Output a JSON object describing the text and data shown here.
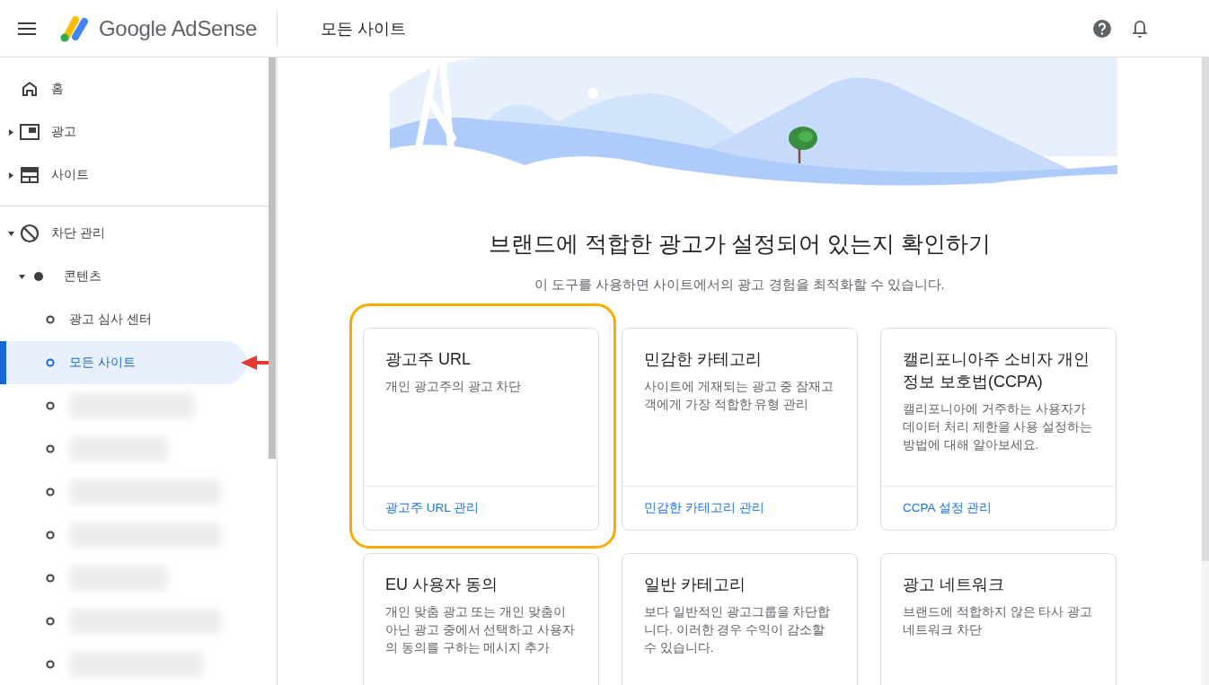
{
  "header": {
    "brand": "Google AdSense",
    "page_title": "모든 사이트"
  },
  "sidebar": {
    "groups": [
      {
        "items": [
          {
            "kind": "home",
            "label": "홈",
            "selected": false
          },
          {
            "kind": "ads",
            "label": "광고",
            "selected": false,
            "expanded": false
          },
          {
            "kind": "sites",
            "label": "사이트",
            "selected": false,
            "expanded": false
          }
        ]
      },
      {
        "items": [
          {
            "kind": "block",
            "label": "차단 관리",
            "selected": false,
            "expanded": true,
            "children": [
              {
                "kind": "dot",
                "label": "콘텐츠",
                "selected": false,
                "expanded": true,
                "children": [
                  {
                    "kind": "ring",
                    "label": "광고 심사 센터",
                    "selected": false
                  },
                  {
                    "kind": "ring",
                    "label": "모든 사이트",
                    "selected": true
                  },
                  {
                    "kind": "redacted",
                    "selected": false
                  },
                  {
                    "kind": "redacted",
                    "selected": false
                  },
                  {
                    "kind": "redacted",
                    "selected": false
                  },
                  {
                    "kind": "redacted",
                    "selected": false
                  },
                  {
                    "kind": "redacted",
                    "selected": false
                  },
                  {
                    "kind": "redacted",
                    "selected": false
                  },
                  {
                    "kind": "redacted",
                    "selected": false
                  }
                ]
              }
            ]
          }
        ]
      }
    ]
  },
  "main": {
    "heading": "브랜드에 적합한 광고가 설정되어 있는지 확인하기",
    "subtitle": "이 도구를 사용하면 사이트에서의 광고 경험을 최적화할 수 있습니다.",
    "cards": [
      {
        "title": "광고주 URL",
        "description": "개인 광고주의 광고 차단",
        "link": "광고주 URL 관리",
        "highlighted": true
      },
      {
        "title": "민감한 카테고리",
        "description": "사이트에 게재되는 광고 중 잠재고객에게 가장 적합한 유형 관리",
        "link": "민감한 카테고리 관리",
        "highlighted": false
      },
      {
        "title": "캘리포니아주 소비자 개인 정보 보호법(CCPA)",
        "description": "캘리포니아에 거주하는 사용자가 데이터 처리 제한을 사용 설정하는 방법에 대해 알아보세요.",
        "link": "CCPA 설정 관리",
        "highlighted": false
      },
      {
        "title": "EU 사용자 동의",
        "description": "개인 맞춤 광고 또는 개인 맞춤이 아닌 광고 중에서 선택하고 사용자의 동의를 구하는 메시지 추가",
        "highlighted": false
      },
      {
        "title": "일반 카테고리",
        "description": "보다 일반적인 광고그룹을 차단합니다. 이러한 경우 수익이 감소할 수 있습니다.",
        "highlighted": false
      },
      {
        "title": "광고 네트워크",
        "description": "브랜드에 적합하지 않은 타사 광고 네트워크 차단",
        "highlighted": false
      }
    ]
  }
}
